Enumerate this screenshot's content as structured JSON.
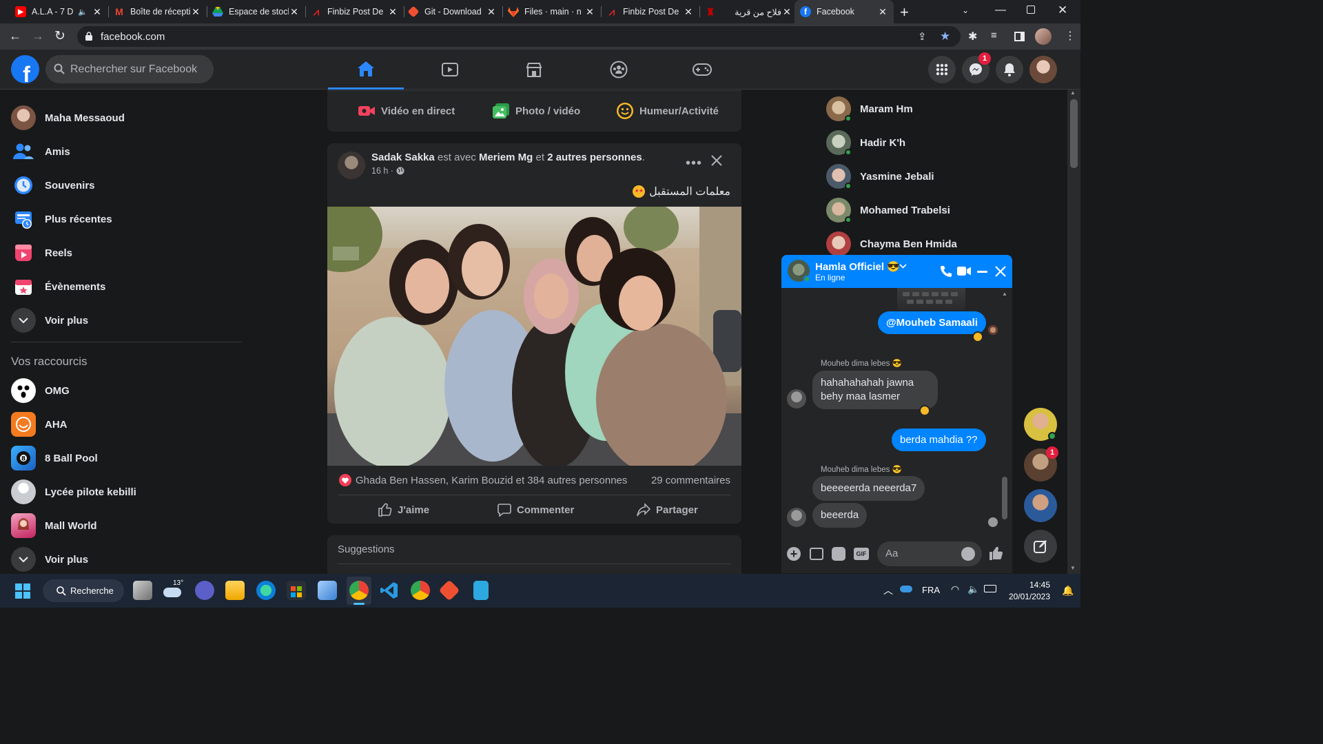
{
  "browser": {
    "tabs": [
      {
        "title": "A.L.A - 7 D",
        "icon": "youtube-icon",
        "color": "#ff0000"
      },
      {
        "title": "Boîte de réception",
        "icon": "gmail-icon",
        "color": "#ea4335"
      },
      {
        "title": "Espace de stockage",
        "icon": "drive-icon",
        "color": "#fbbc04"
      },
      {
        "title": "Finbiz Post De",
        "icon": "finbiz-icon",
        "color": "#e02020"
      },
      {
        "title": "Git - Download",
        "icon": "git-icon",
        "color": "#f05032"
      },
      {
        "title": "Files · main · n",
        "icon": "gitlab-icon",
        "color": "#fc6d26"
      },
      {
        "title": "Finbiz Post De",
        "icon": "finbiz-icon",
        "color": "#e02020"
      },
      {
        "title": "فلاح من قرية",
        "icon": "page-icon",
        "color": "#c00000"
      },
      {
        "title": "Facebook",
        "icon": "facebook-icon",
        "color": "#1877f2"
      }
    ],
    "url": "facebook.com"
  },
  "header": {
    "search_placeholder": "Rechercher sur Facebook",
    "messenger_badge": "1"
  },
  "sidebar": {
    "items": [
      {
        "label": "Maha Messaoud",
        "icon": "profile-avatar"
      },
      {
        "label": "Amis",
        "icon": "friends-icon"
      },
      {
        "label": "Souvenirs",
        "icon": "memories-icon"
      },
      {
        "label": "Plus récentes",
        "icon": "feeds-icon"
      },
      {
        "label": "Reels",
        "icon": "reels-icon"
      },
      {
        "label": "Évènements",
        "icon": "events-icon"
      },
      {
        "label": "Voir plus",
        "icon": "chevron-down-icon"
      }
    ],
    "shortcuts_title": "Vos raccourcis",
    "shortcuts": [
      {
        "label": "OMG"
      },
      {
        "label": "AHA"
      },
      {
        "label": "8 Ball Pool"
      },
      {
        "label": "Lycée pilote kebilli"
      },
      {
        "label": "Mall World"
      },
      {
        "label": "Voir plus"
      }
    ]
  },
  "composer": {
    "live": "Vidéo en direct",
    "photo": "Photo / vidéo",
    "feeling": "Humeur/Activité"
  },
  "post": {
    "author": "Sadak Sakka",
    "with_text": "est avec",
    "tagged": "Meriem Mg",
    "and_text": "et",
    "others": "2 autres personnes",
    "time": "16 h ·",
    "caption": "معلمات المستقبل",
    "reactions": "Ghada Ben Hassen, Karim Bouzid et 384 autres personnes",
    "comments": "29 commentaires",
    "like": "J'aime",
    "comment": "Commenter",
    "share": "Partager"
  },
  "suggestions_title": "Suggestions",
  "contacts": [
    {
      "name": "Maram Hm"
    },
    {
      "name": "Hadir K'h"
    },
    {
      "name": "Yasmine Jebali"
    },
    {
      "name": "Mohamed Trabelsi"
    },
    {
      "name": "Chayma Ben Hmida"
    }
  ],
  "chat": {
    "name": "Hamla Officiel 😎",
    "status": "En ligne",
    "messages": {
      "m1": "@Mouheb Samaali",
      "sender1": "Mouheb dima lebes 😎",
      "m2_line1": "hahahahahah jawna",
      "m2_line2": "behy maa lasmer",
      "m3": "berda mahdia ??",
      "sender2": "Mouheb dima lebes 😎",
      "m4": "beeeeerda neeerda7",
      "m5": "beeerda"
    },
    "input_placeholder": "Aa",
    "bubble_badge": "1"
  },
  "taskbar": {
    "search": "Recherche",
    "weather": "13°",
    "lang": "FRA",
    "time": "14:45",
    "date": "20/01/2023"
  }
}
